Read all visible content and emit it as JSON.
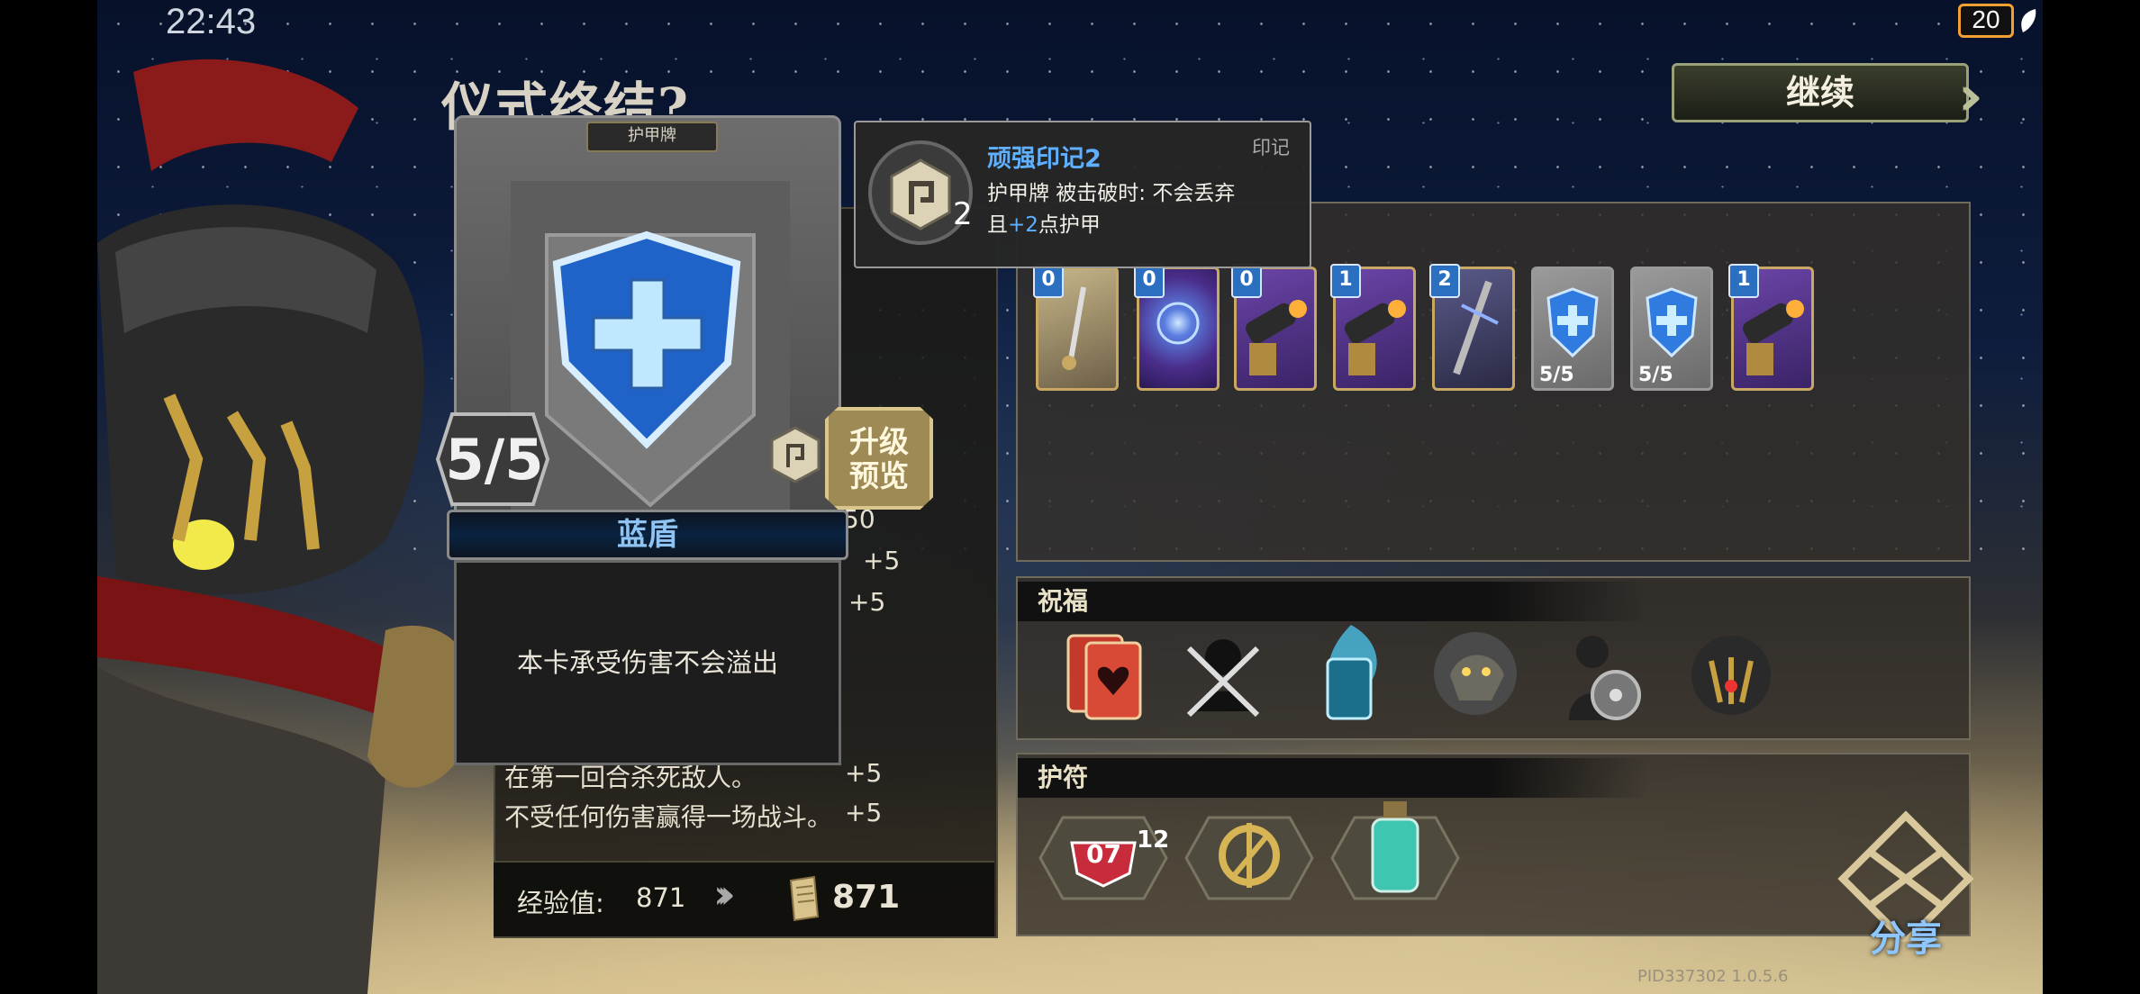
{
  "status_bar": {
    "time": "22:43",
    "battery": "20"
  },
  "title": "仪式终结?",
  "continue_button": {
    "label": "继续"
  },
  "results": {
    "rows": [
      {
        "text": "",
        "value": "50"
      },
      {
        "text": "",
        "value": "+5"
      },
      {
        "text": "",
        "value": "+5"
      },
      {
        "text": "在第一回合杀死敌人。",
        "value": "+5"
      },
      {
        "text": "不受任何伤害赢得一场战斗。",
        "value": "+5"
      }
    ],
    "xp_label": "经验值:",
    "xp_value": "871",
    "xp_total": "871"
  },
  "deck": {
    "cards": [
      {
        "cost": "0",
        "art": "dagger-scroll",
        "hp": ""
      },
      {
        "cost": "0",
        "art": "purple-orb",
        "hp": ""
      },
      {
        "cost": "0",
        "art": "cannon",
        "hp": ""
      },
      {
        "cost": "1",
        "art": "cannon",
        "hp": ""
      },
      {
        "cost": "2",
        "art": "crossbow",
        "hp": ""
      },
      {
        "cost": "",
        "art": "blue-shield",
        "hp": "5/5"
      },
      {
        "cost": "",
        "art": "blue-shield",
        "hp": "5/5"
      },
      {
        "cost": "1",
        "art": "cannon",
        "hp": ""
      }
    ]
  },
  "blessings": {
    "title": "祝福",
    "icons": [
      "heart-cards-icon",
      "crossed-blades-icon",
      "blue-flame-card-icon",
      "beast-head-icon",
      "shield-warrior-icon",
      "masked-helm-icon"
    ]
  },
  "amulets": {
    "title": "护符",
    "badge_value": "07",
    "badge_count": "12",
    "icons": [
      "badge-07-icon",
      "golden-compass-icon",
      "potion-bottle-icon"
    ]
  },
  "card": {
    "type": "护甲牌",
    "name": "蓝盾",
    "description": "本卡承受伤害不会溢出",
    "hp": "5/5",
    "mark_count": "2"
  },
  "upgrade_button": {
    "line1": "升级",
    "line2": "预览"
  },
  "tooltip": {
    "title": "顽强印记2",
    "tag": "印记",
    "line1_prefix": "护甲牌 被击破时: 不会丢弃",
    "line2_prefix": "且",
    "line2_value": "+2",
    "line2_suffix": "点护甲",
    "icon_number": "2"
  },
  "share": {
    "label": "分享"
  },
  "version": "PID337302  1.0.5.6",
  "colors": {
    "accent_blue": "#5fb0ff",
    "gold": "#c9a864",
    "battery": "#f2a031"
  }
}
